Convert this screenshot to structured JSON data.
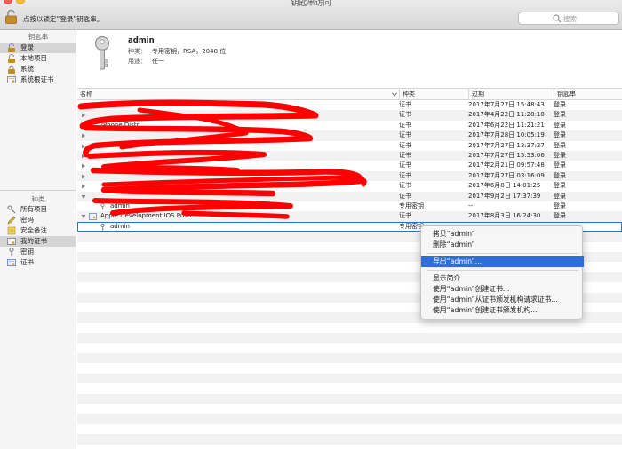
{
  "window": {
    "title": "钥匙串访问",
    "lock_text": "点按以锁定“登录”钥匙串。"
  },
  "search": {
    "placeholder": "搜索"
  },
  "sidebar": {
    "keychains_header": "钥匙串",
    "keychains": [
      {
        "label": "登录",
        "icon": "lock-open-icon",
        "selected": true
      },
      {
        "label": "本地项目",
        "icon": "lock-open-icon",
        "selected": false
      },
      {
        "label": "系统",
        "icon": "lock-icon",
        "selected": false
      },
      {
        "label": "系统根证书",
        "icon": "certificate-icon",
        "selected": false
      }
    ],
    "category_header": "种类",
    "categories": [
      {
        "label": "所有项目",
        "icon": "keys-icon",
        "selected": false
      },
      {
        "label": "密码",
        "icon": "pencil-icon",
        "selected": false
      },
      {
        "label": "安全备注",
        "icon": "note-icon",
        "selected": false
      },
      {
        "label": "我的证书",
        "icon": "certificate-icon",
        "selected": true
      },
      {
        "label": "密钥",
        "icon": "key-icon",
        "selected": false
      },
      {
        "label": "证书",
        "icon": "certificate-icon",
        "selected": false
      }
    ]
  },
  "info": {
    "name": "admin",
    "kind_label": "种类：",
    "kind_value": "专用密钥，RSA，2048 位",
    "usage_label": "用途：",
    "usage_value": "任一"
  },
  "table": {
    "columns": {
      "name": "名称",
      "kind": "种类",
      "expires": "过期",
      "keychain": "钥匙串"
    },
    "rows": [
      {
        "name": "",
        "kind": "证书",
        "expires": "2017年7月27日 15:48:43",
        "keychain": "登录"
      },
      {
        "name": "",
        "kind": "证书",
        "expires": "2017年4月22日 11:28:18",
        "keychain": "登录"
      },
      {
        "name": "iPhone Distr",
        "kind": "证书",
        "expires": "2017年6月22日 11:21:21",
        "keychain": "登录"
      },
      {
        "name": "",
        "kind": "证书",
        "expires": "2017年7月28日 10:05:19",
        "keychain": "登录"
      },
      {
        "name": "",
        "kind": "证书",
        "expires": "2017年7月27日 13:37:27",
        "keychain": "登录"
      },
      {
        "name": "",
        "kind": "证书",
        "expires": "2017年7月27日 15:53:06",
        "keychain": "登录"
      },
      {
        "name": "",
        "kind": "证书",
        "expires": "2017年2月21日 09:57:48",
        "keychain": "登录"
      },
      {
        "name": "",
        "kind": "证书",
        "expires": "2017年7月27日 03:16:09",
        "keychain": "登录"
      },
      {
        "name": "",
        "kind": "证书",
        "expires": "2017年6月8日 14:01:25",
        "keychain": "登录"
      },
      {
        "name": "",
        "kind": "证书",
        "expires": "2017年9月2日 17:37:39",
        "keychain": "登录"
      },
      {
        "name": "admin",
        "kind": "专用密钥",
        "expires": "--",
        "keychain": "登录"
      },
      {
        "name": "Apple Development IOS Push",
        "kind": "证书",
        "expires": "2017年8月3日 16:24:30",
        "keychain": "登录"
      },
      {
        "name": "admin",
        "kind": "专用密钥",
        "expires": "",
        "keychain": ""
      }
    ]
  },
  "context_menu": {
    "copy": "拷贝“admin”",
    "delete": "删除“admin”",
    "export": "导出“admin”...",
    "get_info": "显示简介",
    "create_cert": "使用“admin”创建证书...",
    "request_cert": "使用“admin”从证书颁发机构请求证书...",
    "create_ca": "使用“admin”创建证书颁发机构..."
  },
  "colors": {
    "accent": "#2f6ed8",
    "redaction": "#ff0000"
  }
}
